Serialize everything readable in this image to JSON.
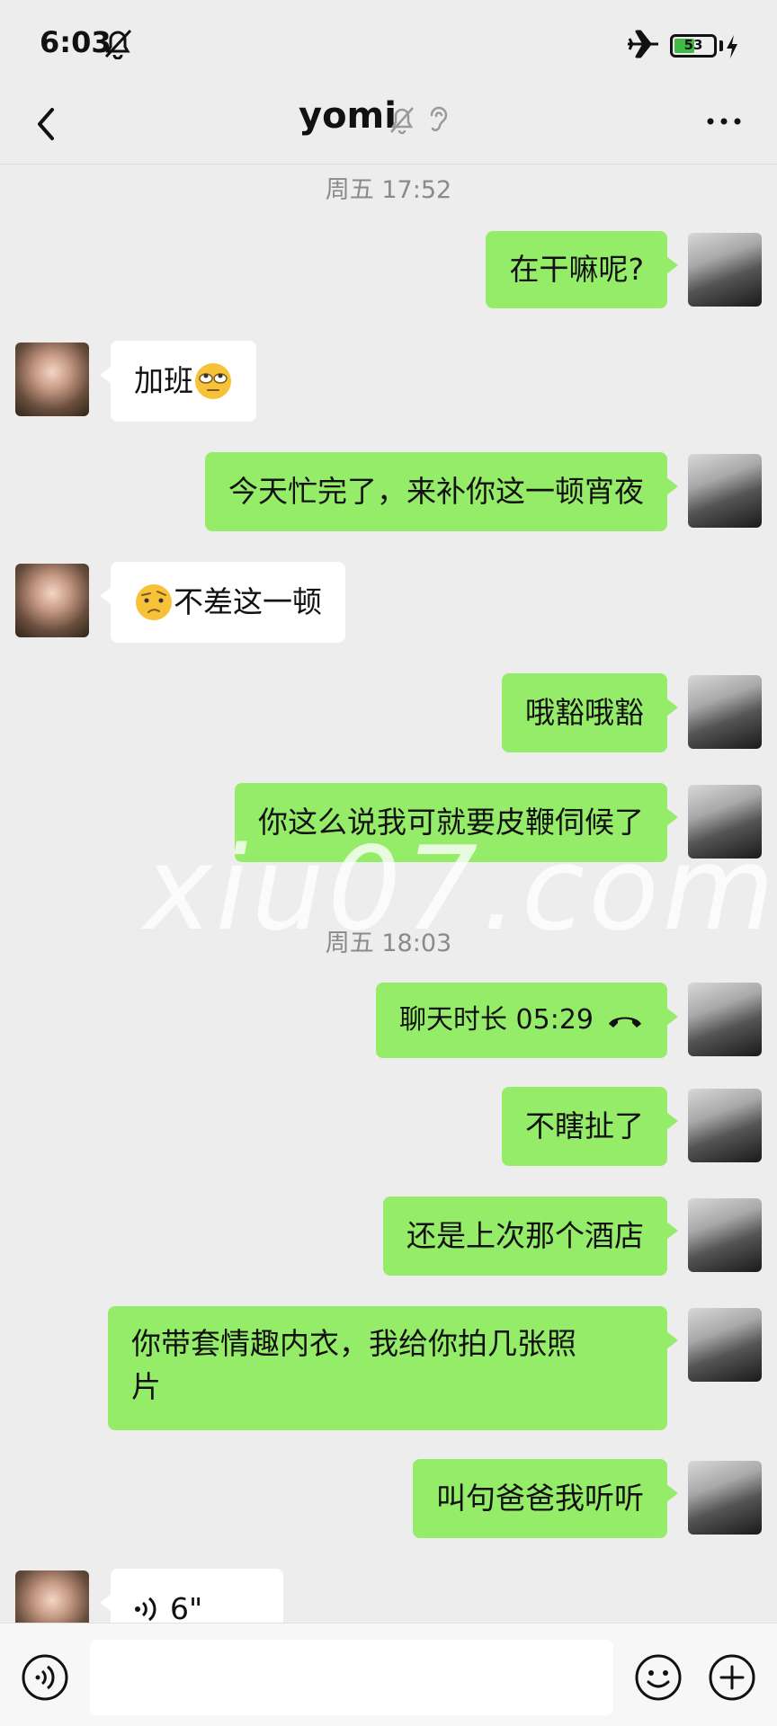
{
  "status_bar": {
    "time": "6:03",
    "battery": "53",
    "battery_level": 0.53
  },
  "header": {
    "title": "yomi"
  },
  "chat": {
    "separators": [
      "周五 17:52",
      "周五 18:03"
    ],
    "messages": [
      {
        "from": "me",
        "text": "在干嘛呢?"
      },
      {
        "from": "them",
        "text": "加班",
        "emoji": "eye-roll-emoji"
      },
      {
        "from": "me",
        "text": "今天忙完了，来补你这一顿宵夜"
      },
      {
        "from": "them",
        "text": "不差这一顿",
        "emoji": "thinking-emoji"
      },
      {
        "from": "me",
        "text": "哦豁哦豁"
      },
      {
        "from": "me",
        "text": "你这么说我可就要皮鞭伺候了"
      },
      {
        "from": "me",
        "type": "call",
        "text": "聊天时长 05:29",
        "icon": "hang-up-phone-icon"
      },
      {
        "from": "me",
        "text": "不瞎扯了"
      },
      {
        "from": "me",
        "text": "还是上次那个酒店"
      },
      {
        "from": "me",
        "text": "你带套情趣内衣，我给你拍几张照\n片"
      },
      {
        "from": "me",
        "text": "叫句爸爸我听听"
      },
      {
        "from": "them",
        "type": "voice",
        "text": "6\""
      }
    ]
  },
  "watermark": "xiu07.com",
  "colors": {
    "background": "#ededed",
    "my_bubble": "#95ec69",
    "their_bubble": "#ffffff",
    "timestamp": "#8a8a8a"
  }
}
